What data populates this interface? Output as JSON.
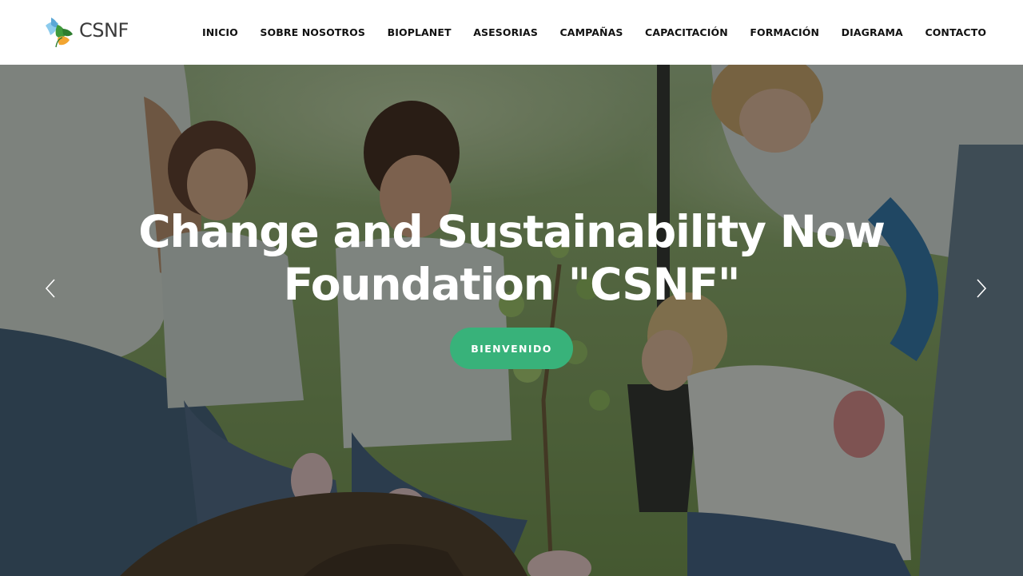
{
  "brand": {
    "name": "CSNF",
    "logo_icon": "leaf-logo-icon",
    "colors": {
      "blue": "#7fc4e8",
      "green": "#3f9a3b",
      "orange": "#f2a531",
      "text": "#3a3a3a"
    }
  },
  "nav": {
    "items": [
      {
        "label": "INICIO"
      },
      {
        "label": "SOBRE NOSOTROS"
      },
      {
        "label": "BIOPLANET"
      },
      {
        "label": "ASESORIAS"
      },
      {
        "label": "CAMPAÑAS"
      },
      {
        "label": "CAPACITACIÓN"
      },
      {
        "label": "FORMACIÓN"
      },
      {
        "label": "DIAGRAMA"
      },
      {
        "label": "CONTACTO"
      }
    ]
  },
  "hero": {
    "title_line1": "Change and Sustainability Now",
    "title_line2": "Foundation \"CSNF\"",
    "cta_label": "BIENVENIDO",
    "cta_color": "#38b27a",
    "prev_icon": "chevron-left-icon",
    "next_icon": "chevron-right-icon",
    "photo": "volunteers-planting-tree-photo"
  }
}
